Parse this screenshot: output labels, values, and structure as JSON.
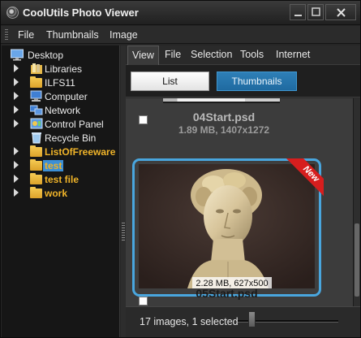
{
  "window": {
    "title": "CoolUtils Photo Viewer"
  },
  "menu": {
    "items": [
      "File",
      "Thumbnails",
      "Image"
    ]
  },
  "tree": {
    "items": [
      {
        "label": "Desktop",
        "icon": "desktop-icon"
      },
      {
        "label": "Libraries",
        "icon": "libraries-icon"
      },
      {
        "label": "ILFS11",
        "icon": "user-folder-icon"
      },
      {
        "label": "Computer",
        "icon": "computer-icon"
      },
      {
        "label": "Network",
        "icon": "network-icon"
      },
      {
        "label": "Control Panel",
        "icon": "control-panel-icon"
      },
      {
        "label": "Recycle Bin",
        "icon": "recycle-bin-icon"
      },
      {
        "label": "ListOfFreeware",
        "icon": "folder-icon"
      },
      {
        "label": "test",
        "icon": "folder-icon",
        "selected": true
      },
      {
        "label": "test file",
        "icon": "folder-icon"
      },
      {
        "label": "work",
        "icon": "folder-icon"
      }
    ]
  },
  "tabs": [
    "View",
    "File",
    "Selection",
    "Tools",
    "Internet"
  ],
  "active_tab": "View",
  "view_buttons": {
    "list": "List",
    "thumbnails": "Thumbnails",
    "active": "Thumbnails"
  },
  "gallery": {
    "items": [
      {
        "name": "04Start.psd",
        "meta": "1.89 MB, 1407x1272"
      },
      {
        "name": "05Start.psd",
        "meta": "2.28 MB, 627x500",
        "badge": "New",
        "selected": true
      }
    ]
  },
  "status": {
    "text": "17 images, 1 selected"
  },
  "colors": {
    "accent": "#49a6de",
    "folder_label": "#f0b429",
    "badge": "#d61e1e"
  }
}
